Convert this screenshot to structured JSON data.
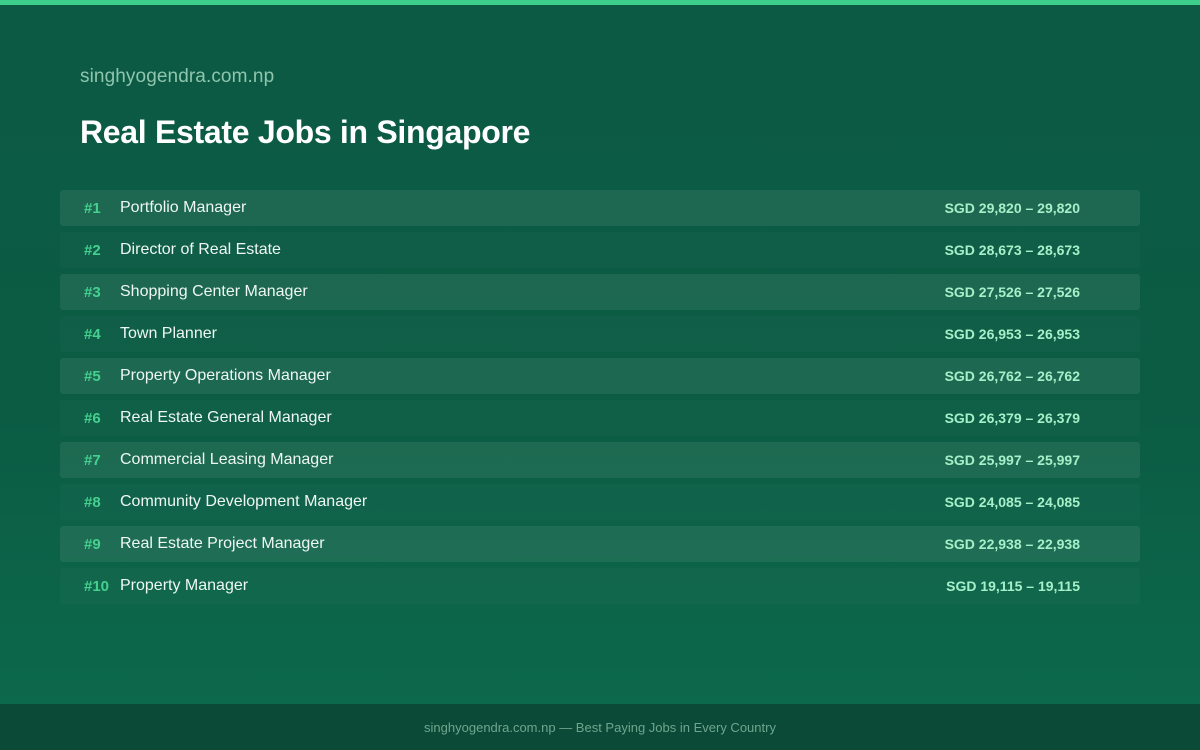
{
  "colors": {
    "accent": "#3ccf8c",
    "rank": "#44d08f",
    "salary": "#a6f0c9",
    "background": "#0b5c43"
  },
  "header": {
    "site": "singhyogendra.com.np",
    "title": "Real Estate Jobs in Singapore"
  },
  "jobs": [
    {
      "rank": "#1",
      "title": "Portfolio Manager",
      "salary": "SGD 29,820 – 29,820"
    },
    {
      "rank": "#2",
      "title": "Director of Real Estate",
      "salary": "SGD 28,673 – 28,673"
    },
    {
      "rank": "#3",
      "title": "Shopping Center Manager",
      "salary": "SGD 27,526 – 27,526"
    },
    {
      "rank": "#4",
      "title": "Town Planner",
      "salary": "SGD 26,953 – 26,953"
    },
    {
      "rank": "#5",
      "title": "Property Operations Manager",
      "salary": "SGD 26,762 – 26,762"
    },
    {
      "rank": "#6",
      "title": "Real Estate General Manager",
      "salary": "SGD 26,379 – 26,379"
    },
    {
      "rank": "#7",
      "title": "Commercial Leasing Manager",
      "salary": "SGD 25,997 – 25,997"
    },
    {
      "rank": "#8",
      "title": "Community Development Manager",
      "salary": "SGD 24,085 – 24,085"
    },
    {
      "rank": "#9",
      "title": "Real Estate Project Manager",
      "salary": "SGD 22,938 – 22,938"
    },
    {
      "rank": "#10",
      "title": "Property Manager",
      "salary": "SGD 19,115 – 19,115"
    }
  ],
  "footer": {
    "text": "singhyogendra.com.np — Best Paying Jobs in Every Country"
  }
}
